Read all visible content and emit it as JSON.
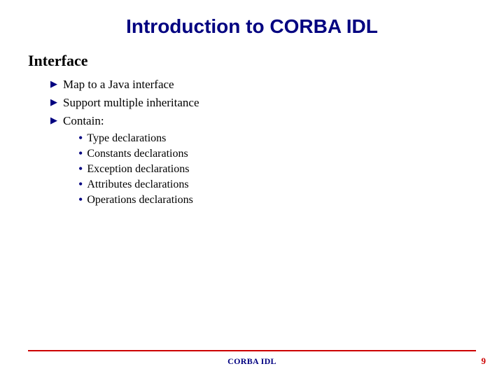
{
  "title": "Introduction to CORBA IDL",
  "heading": "Interface",
  "bullets": [
    "Map to a Java interface",
    "Support multiple inheritance",
    "Contain:"
  ],
  "subBullets": [
    "Type declarations",
    "Constants declarations",
    "Exception declarations",
    "Attributes declarations",
    "Operations declarations"
  ],
  "footer": {
    "center": "CORBA IDL",
    "page": "9"
  },
  "colors": {
    "titleColor": "#000080",
    "ruleColor": "#cc0000"
  }
}
